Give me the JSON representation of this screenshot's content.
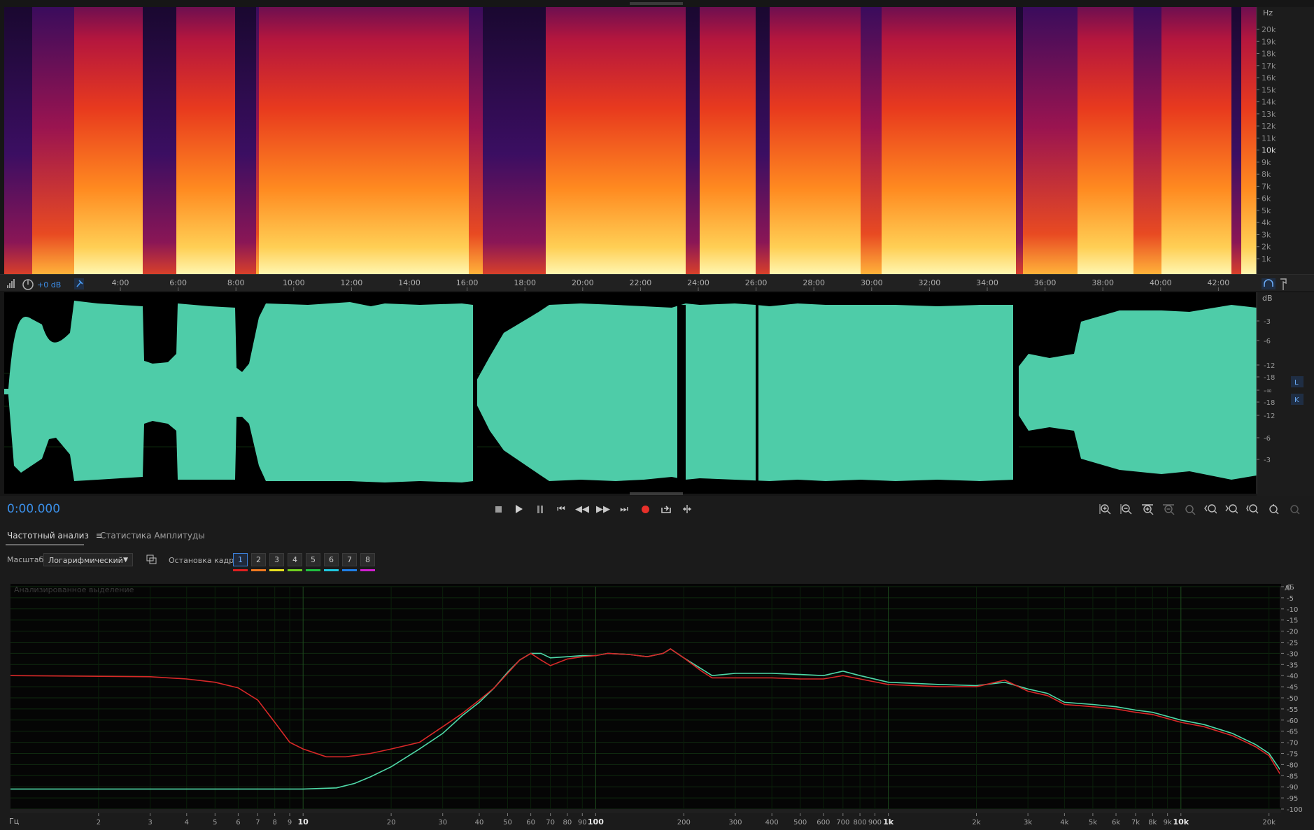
{
  "spectrogram": {
    "unit_label": "Hz",
    "freq_labels": [
      "20k",
      "19k",
      "18k",
      "17k",
      "16k",
      "15k",
      "14k",
      "13k",
      "12k",
      "11k",
      "10k",
      "9k",
      "8k",
      "7k",
      "6k",
      "5k",
      "4k",
      "3k",
      "2k",
      "1k"
    ]
  },
  "timeline": {
    "volume": "+0 dB",
    "time_labels": [
      "4:00",
      "6:00",
      "8:00",
      "10:00",
      "12:00",
      "14:00",
      "16:00",
      "18:00",
      "20:00",
      "22:00",
      "24:00",
      "26:00",
      "28:00",
      "30:00",
      "32:00",
      "34:00",
      "36:00",
      "38:00",
      "40:00",
      "42:00"
    ]
  },
  "waveform": {
    "db_unit": "dB",
    "db_labels": [
      "-3",
      "-6",
      "-12",
      "-18",
      "-∞",
      "-18",
      "-12",
      "-6",
      "-3"
    ],
    "channel_l": "L",
    "channel_r": "K",
    "color": "#4ecca8"
  },
  "transport": {
    "timecode": "0:00.000"
  },
  "panel": {
    "tabs": [
      {
        "label": "Частотный анализ",
        "active": true
      },
      {
        "label": "Статистика Амплитуды",
        "active": false
      }
    ],
    "scale_label": "Масштаб:",
    "scale_value": "Логарифмический",
    "freeze_label": "Остановка кадра:",
    "freeze_frames": [
      "1",
      "2",
      "3",
      "4",
      "5",
      "6",
      "7",
      "8"
    ],
    "freeze_colors": [
      "#e02020",
      "#f07a20",
      "#e8e020",
      "#70d020",
      "#20c040",
      "#20c8e0",
      "#2080e8",
      "#d020d0"
    ]
  },
  "spectrum": {
    "caption": "Анализированное выделение",
    "db_unit": "дБ",
    "x_unit": "Гц"
  },
  "chart_data": {
    "type": "line",
    "title": "",
    "xlabel": "Гц",
    "ylabel": "дБ",
    "xscale": "log",
    "xlim": [
      1,
      22000
    ],
    "ylim": [
      -100,
      0
    ],
    "x_ticks": [
      {
        "v": 2,
        "l": "2"
      },
      {
        "v": 3,
        "l": "3"
      },
      {
        "v": 4,
        "l": "4"
      },
      {
        "v": 5,
        "l": "5"
      },
      {
        "v": 6,
        "l": "6"
      },
      {
        "v": 7,
        "l": "7"
      },
      {
        "v": 8,
        "l": "8"
      },
      {
        "v": 9,
        "l": "9"
      },
      {
        "v": 10,
        "l": "10"
      },
      {
        "v": 20,
        "l": "20"
      },
      {
        "v": 30,
        "l": "30"
      },
      {
        "v": 40,
        "l": "40"
      },
      {
        "v": 50,
        "l": "50"
      },
      {
        "v": 60,
        "l": "60"
      },
      {
        "v": 70,
        "l": "70"
      },
      {
        "v": 80,
        "l": "80"
      },
      {
        "v": 90,
        "l": "90"
      },
      {
        "v": 100,
        "l": "100"
      },
      {
        "v": 200,
        "l": "200"
      },
      {
        "v": 300,
        "l": "300"
      },
      {
        "v": 400,
        "l": "400"
      },
      {
        "v": 500,
        "l": "500"
      },
      {
        "v": 600,
        "l": "600"
      },
      {
        "v": 700,
        "l": "700"
      },
      {
        "v": 800,
        "l": "800"
      },
      {
        "v": 900,
        "l": "900"
      },
      {
        "v": 1000,
        "l": "1k"
      },
      {
        "v": 2000,
        "l": "2k"
      },
      {
        "v": 3000,
        "l": "3k"
      },
      {
        "v": 4000,
        "l": "4k"
      },
      {
        "v": 5000,
        "l": "5k"
      },
      {
        "v": 6000,
        "l": "6k"
      },
      {
        "v": 7000,
        "l": "7k"
      },
      {
        "v": 8000,
        "l": "8k"
      },
      {
        "v": 9000,
        "l": "9k"
      },
      {
        "v": 10000,
        "l": "10k"
      },
      {
        "v": 20000,
        "l": "20k"
      }
    ],
    "y_ticks": [
      0,
      -5,
      -10,
      -15,
      -20,
      -25,
      -30,
      -35,
      -40,
      -45,
      -50,
      -55,
      -60,
      -65,
      -70,
      -75,
      -80,
      -85,
      -90,
      -95,
      -100
    ],
    "series": [
      {
        "color": "#4fd8a8",
        "points": [
          [
            1,
            -91
          ],
          [
            5,
            -91
          ],
          [
            10,
            -91
          ],
          [
            13,
            -90.5
          ],
          [
            15,
            -88.5
          ],
          [
            17,
            -85.5
          ],
          [
            20,
            -81
          ],
          [
            25,
            -73
          ],
          [
            30,
            -66
          ],
          [
            35,
            -58
          ],
          [
            40,
            -52
          ],
          [
            45,
            -45.5
          ],
          [
            50,
            -38.5
          ],
          [
            55,
            -33
          ],
          [
            60,
            -30
          ],
          [
            65,
            -30
          ],
          [
            70,
            -32
          ],
          [
            80,
            -31.5
          ],
          [
            90,
            -31
          ],
          [
            100,
            -31
          ],
          [
            110,
            -30
          ],
          [
            130,
            -30.5
          ],
          [
            150,
            -31.5
          ],
          [
            170,
            -30
          ],
          [
            180,
            -28
          ],
          [
            200,
            -32
          ],
          [
            230,
            -37
          ],
          [
            250,
            -40
          ],
          [
            300,
            -39
          ],
          [
            400,
            -39
          ],
          [
            500,
            -39.5
          ],
          [
            600,
            -40
          ],
          [
            700,
            -38
          ],
          [
            800,
            -40
          ],
          [
            1000,
            -43
          ],
          [
            1500,
            -44
          ],
          [
            2000,
            -44.5
          ],
          [
            2500,
            -43
          ],
          [
            3000,
            -46
          ],
          [
            3500,
            -48
          ],
          [
            4000,
            -52
          ],
          [
            5000,
            -53
          ],
          [
            6000,
            -54
          ],
          [
            7000,
            -55.5
          ],
          [
            8000,
            -56.5
          ],
          [
            10000,
            -60
          ],
          [
            12000,
            -62
          ],
          [
            15000,
            -66
          ],
          [
            18000,
            -71
          ],
          [
            20000,
            -75
          ],
          [
            22000,
            -83
          ]
        ]
      },
      {
        "color": "#d82828",
        "points": [
          [
            1,
            -40
          ],
          [
            3,
            -40.5
          ],
          [
            4,
            -41.5
          ],
          [
            5,
            -43
          ],
          [
            6,
            -45.5
          ],
          [
            7,
            -51
          ],
          [
            8,
            -61
          ],
          [
            9,
            -70
          ],
          [
            10,
            -73
          ],
          [
            12,
            -76.5
          ],
          [
            14,
            -76.5
          ],
          [
            17,
            -75
          ],
          [
            20,
            -73
          ],
          [
            25,
            -70
          ],
          [
            30,
            -63
          ],
          [
            35,
            -57
          ],
          [
            40,
            -51
          ],
          [
            45,
            -45.5
          ],
          [
            50,
            -39
          ],
          [
            55,
            -33
          ],
          [
            60,
            -30
          ],
          [
            65,
            -33
          ],
          [
            70,
            -35.5
          ],
          [
            80,
            -32.5
          ],
          [
            90,
            -31.5
          ],
          [
            100,
            -31
          ],
          [
            110,
            -30
          ],
          [
            130,
            -30.5
          ],
          [
            150,
            -31.5
          ],
          [
            170,
            -30
          ],
          [
            180,
            -28
          ],
          [
            200,
            -32
          ],
          [
            230,
            -38
          ],
          [
            250,
            -41
          ],
          [
            300,
            -41
          ],
          [
            400,
            -41
          ],
          [
            500,
            -41.5
          ],
          [
            600,
            -41.5
          ],
          [
            700,
            -40
          ],
          [
            800,
            -41.5
          ],
          [
            1000,
            -44
          ],
          [
            1500,
            -45
          ],
          [
            2000,
            -45
          ],
          [
            2500,
            -42
          ],
          [
            3000,
            -47
          ],
          [
            3500,
            -49
          ],
          [
            4000,
            -53
          ],
          [
            5000,
            -54
          ],
          [
            6000,
            -55
          ],
          [
            7000,
            -56.5
          ],
          [
            8000,
            -57.5
          ],
          [
            10000,
            -61
          ],
          [
            12000,
            -63
          ],
          [
            15000,
            -67
          ],
          [
            18000,
            -72
          ],
          [
            20000,
            -76
          ],
          [
            22000,
            -85
          ]
        ]
      }
    ]
  }
}
